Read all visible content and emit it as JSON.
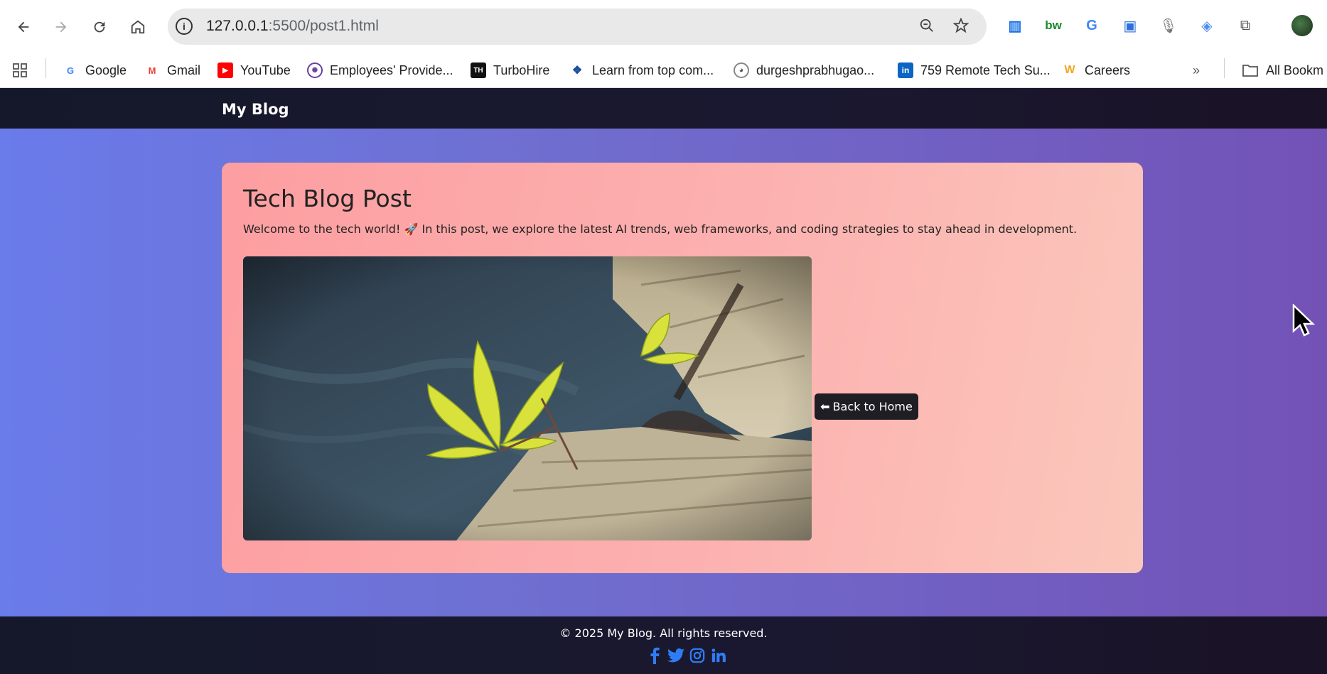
{
  "browser": {
    "url_host": "127.0.0.1",
    "url_rest": ":5500/post1.html",
    "bookmarks": [
      {
        "label": "Google",
        "icon": "google-icon",
        "color": "#4285f4"
      },
      {
        "label": "Gmail",
        "icon": "gmail-icon",
        "color": "#ea4335"
      },
      {
        "label": "YouTube",
        "icon": "youtube-icon",
        "color": "#ff0000"
      },
      {
        "label": "Employees' Provide...",
        "icon": "epfo-icon",
        "color": "#6b3fa0"
      },
      {
        "label": "TurboHire",
        "icon": "turbohire-icon",
        "color": "#111111"
      },
      {
        "label": "Learn from top com...",
        "icon": "learn-icon",
        "color": "#1a4fa0"
      },
      {
        "label": "durgeshprabhugao...",
        "icon": "github-icon",
        "color": "#333333"
      },
      {
        "label": "759 Remote Tech Su...",
        "icon": "linkedin-icon",
        "color": "#0a66c2"
      },
      {
        "label": "Careers",
        "icon": "careers-icon",
        "color": "#f5a623"
      }
    ],
    "all_bookmarks_label": "All Bookm"
  },
  "site": {
    "brand": "My Blog"
  },
  "post": {
    "title": "Tech Blog Post",
    "text": "Welcome to the tech world! 🚀 In this post, we explore the latest AI trends, web frameworks, and coding strategies to stay ahead in development.",
    "back_label": "Back to Home"
  },
  "footer": {
    "copyright": "© 2025 My Blog. All rights reserved.",
    "socials": [
      "facebook-icon",
      "twitter-icon",
      "instagram-icon",
      "linkedin-icon"
    ],
    "social_color": "#2f7df6"
  }
}
